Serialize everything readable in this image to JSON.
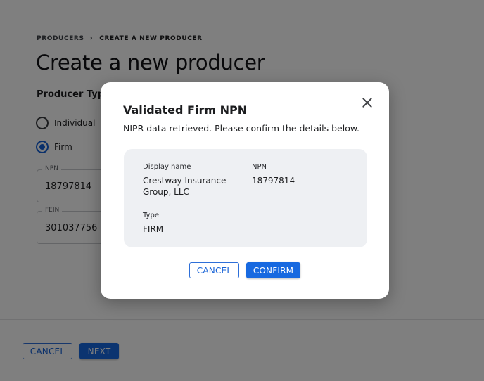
{
  "breadcrumb": {
    "link": "PRODUCERS",
    "separator": "›",
    "current": "CREATE A NEW PRODUCER"
  },
  "page": {
    "title": "Create a new producer",
    "producer_type_label": "Producer Type",
    "radio_individual": "Individual",
    "radio_firm": "Firm",
    "selected_type": "Firm"
  },
  "fields": {
    "npn": {
      "label": "NPN",
      "value": "18797814"
    },
    "fein": {
      "label": "FEIN",
      "value": "301037756"
    }
  },
  "footer": {
    "cancel_label": "CANCEL",
    "next_label": "NEXT"
  },
  "modal": {
    "title": "Validated Firm NPN",
    "subtitle": "NIPR data retrieved. Please confirm the details below.",
    "close_icon": "close-icon",
    "details": {
      "display_name_label": "Display name",
      "display_name_line1": "Crestway Insurance",
      "display_name_line2": "Group, LLC",
      "npn_label": "NPN",
      "npn_value": "18797814",
      "type_label": "Type",
      "type_value": "FIRM"
    },
    "cancel_label": "CANCEL",
    "confirm_label": "CONFIRM"
  },
  "colors": {
    "accent": "#1769e0",
    "overlay": "rgba(0,0,0,0.5)",
    "card": "#eef0f3"
  }
}
